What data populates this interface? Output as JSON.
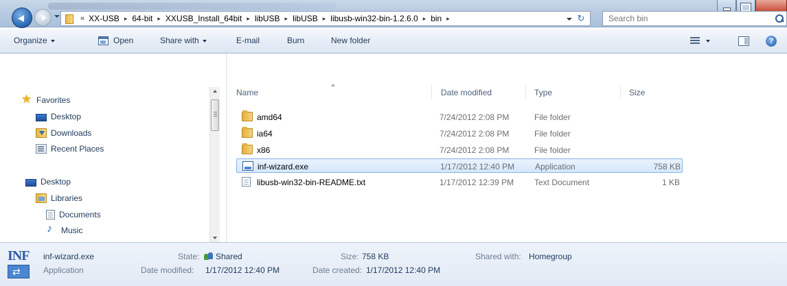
{
  "address": {
    "overflow_glyph": "«",
    "separator": "▸",
    "crumbs": [
      "XX-USB",
      "64-bit",
      "XXUSB_Install_64bit",
      "libUSB",
      "libUSB",
      "libusb-win32-bin-1.2.6.0",
      "bin"
    ],
    "refresh_glyph": "↻"
  },
  "search": {
    "placeholder": "Search bin"
  },
  "toolbar": {
    "organize": "Organize",
    "open": "Open",
    "share_with": "Share with",
    "email": "E-mail",
    "burn": "Burn",
    "new_folder": "New folder",
    "help": "?"
  },
  "navpane": {
    "favorites": "Favorites",
    "fav_desktop": "Desktop",
    "fav_downloads": "Downloads",
    "fav_recent": "Recent Places",
    "desktop": "Desktop",
    "libraries": "Libraries",
    "documents": "Documents",
    "music": "Music"
  },
  "columns": {
    "name": "Name",
    "date": "Date modified",
    "type": "Type",
    "size": "Size"
  },
  "files": [
    {
      "name": "amd64",
      "date": "7/24/2012 2:08 PM",
      "type": "File folder",
      "size": "",
      "icon": "folder-icon"
    },
    {
      "name": "ia64",
      "date": "7/24/2012 2:08 PM",
      "type": "File folder",
      "size": "",
      "icon": "folder-icon"
    },
    {
      "name": "x86",
      "date": "7/24/2012 2:08 PM",
      "type": "File folder",
      "size": "",
      "icon": "folder-icon"
    },
    {
      "name": "inf-wizard.exe",
      "date": "1/17/2012 12:40 PM",
      "type": "Application",
      "size": "758 KB",
      "icon": "application-icon",
      "selected": true
    },
    {
      "name": "libusb-win32-bin-README.txt",
      "date": "1/17/2012 12:39 PM",
      "type": "Text Document",
      "size": "1 KB",
      "icon": "text-document-icon"
    }
  ],
  "details": {
    "icon_text": "INF",
    "name": "inf-wizard.exe",
    "kind": "Application",
    "state_label": "State:",
    "state_value": "Shared",
    "modified_label": "Date modified:",
    "modified_value": "1/17/2012 12:40 PM",
    "size_label": "Size:",
    "size_value": "758 KB",
    "created_label": "Date created:",
    "created_value": "1/17/2012 12:40 PM",
    "shared_label": "Shared with:",
    "shared_value": "Homegroup"
  },
  "colors": {
    "accent": "#1e395b",
    "selection_border": "#86b3e6",
    "toolbar_bg": "#e8eef7",
    "secondary_text": "#6d6d6d"
  }
}
